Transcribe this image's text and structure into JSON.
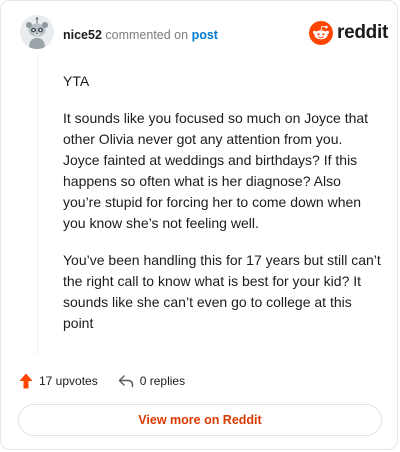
{
  "comment": {
    "username": "nice52",
    "action_text": "commented on",
    "post_link": "post",
    "paragraphs": [
      "YTA",
      "It sounds like you focused so much on Joyce that other Olivia never got any attention from you. Joyce fainted at weddings and birthdays? If this happens so often what is her diagnose? Also you’re stupid for forcing her to come down when you know she’s not feeling well.",
      "You’ve been handling this for 17 years but still can’t the right call to know what is best for your kid? It sounds like she can’t even go to college at this point"
    ]
  },
  "brand": {
    "name": "reddit",
    "color": "#ff4500"
  },
  "stats": {
    "upvotes_label": "17 upvotes",
    "replies_label": "0 replies"
  },
  "cta": {
    "label": "View more on Reddit",
    "color": "#d93a00"
  },
  "icons": {
    "avatar": "snoo-avatar-icon",
    "upvote": "upvote-arrow-icon",
    "reply": "reply-arrow-icon",
    "logo": "reddit-logo-icon"
  }
}
